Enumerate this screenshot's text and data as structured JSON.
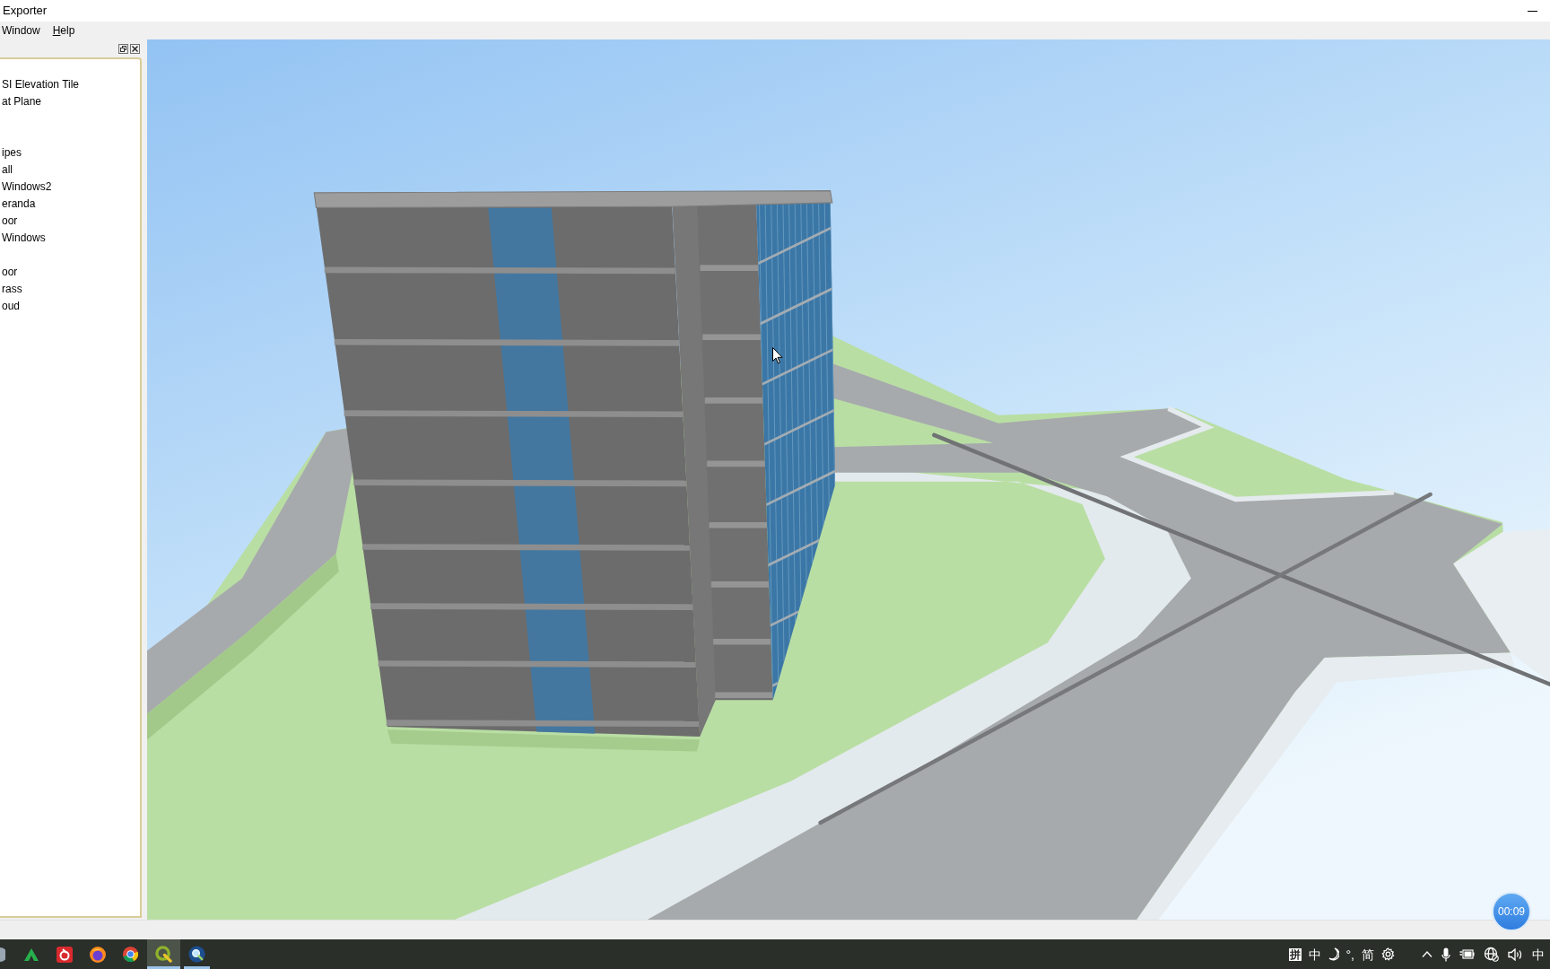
{
  "window": {
    "title": "Exporter"
  },
  "menu": [
    {
      "label": "Window",
      "mnemonic": false
    },
    {
      "label": "Help",
      "mnemonic": true
    }
  ],
  "layer_panel": {
    "tree": [
      {
        "children": [
          {
            "label": "SI Elevation Tile"
          },
          {
            "label": "at Plane"
          }
        ]
      },
      {
        "children": [
          {
            "children": [
              {
                "label": "ipes"
              },
              {
                "label": "all"
              },
              {
                "label": "Windows2"
              },
              {
                "label": "eranda"
              },
              {
                "label": "oor"
              },
              {
                "label": "Windows"
              }
            ]
          }
        ]
      },
      {
        "children": [
          {
            "label": "oor"
          },
          {
            "label": "rass"
          },
          {
            "label": "oud"
          }
        ]
      }
    ]
  },
  "recording_timer": {
    "text": "00:09"
  },
  "taskbar": {
    "apps": [
      {
        "kind": "disc",
        "selected": false,
        "running": false
      },
      {
        "kind": "arch",
        "selected": false,
        "running": false
      },
      {
        "kind": "swirl",
        "selected": false,
        "running": false
      },
      {
        "kind": "orb",
        "selected": false,
        "running": false
      },
      {
        "kind": "ring",
        "selected": false,
        "running": false
      },
      {
        "kind": "qmark",
        "selected": true,
        "running": true
      },
      {
        "kind": "magnifier",
        "selected": false,
        "running": true
      }
    ],
    "input_method": [
      {
        "kind": "boxed",
        "text": "拼"
      },
      {
        "kind": "text",
        "text": "中"
      },
      {
        "kind": "moon"
      },
      {
        "kind": "text",
        "text": "°,"
      },
      {
        "kind": "text",
        "text": "简"
      },
      {
        "kind": "gear"
      }
    ],
    "tray": [
      {
        "kind": "chevron"
      },
      {
        "kind": "mic"
      },
      {
        "kind": "battery"
      },
      {
        "kind": "globe"
      },
      {
        "kind": "speaker"
      },
      {
        "kind": "text",
        "text": "中"
      }
    ]
  }
}
